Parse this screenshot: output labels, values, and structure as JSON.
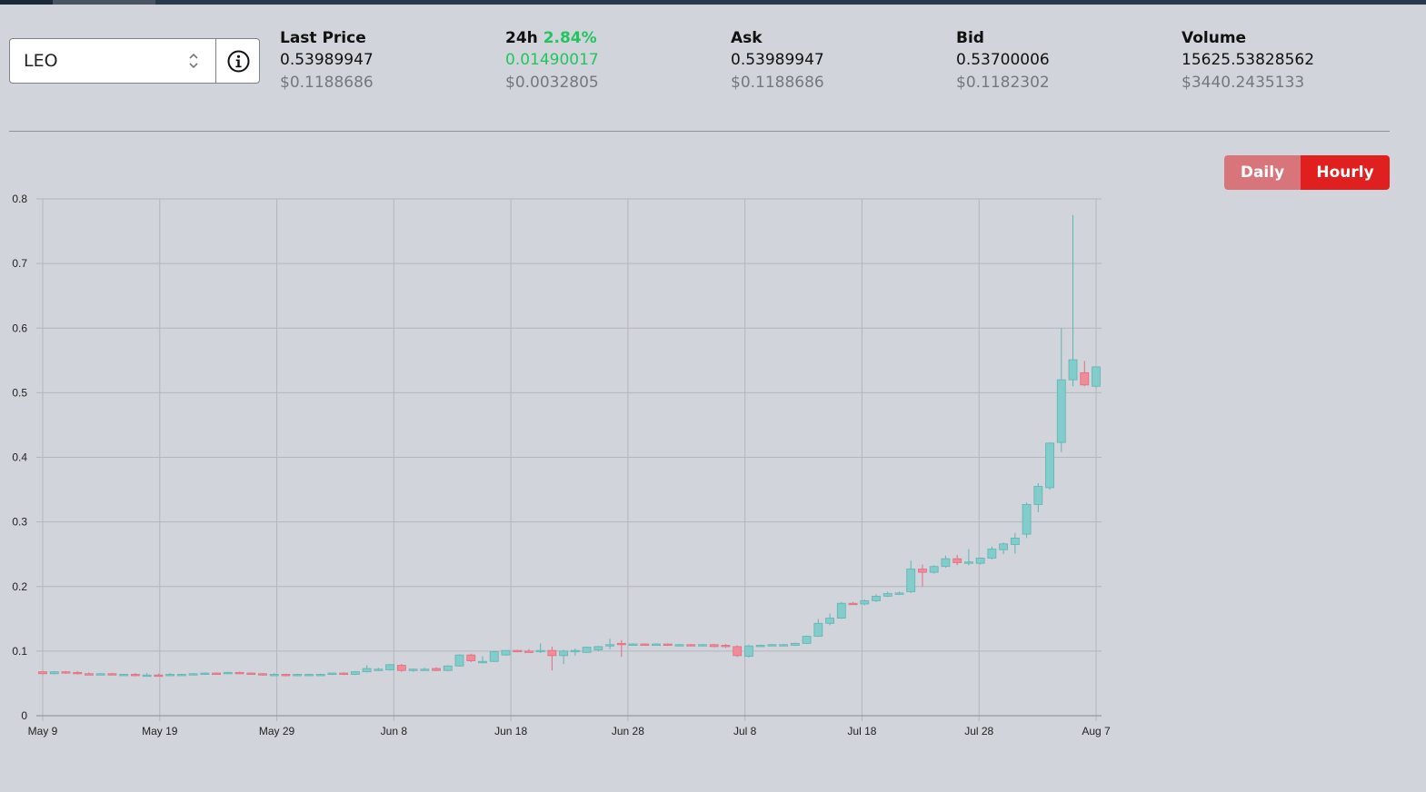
{
  "market": {
    "pair": "LEO",
    "stats": [
      {
        "label": "Last Price",
        "value": "0.53989947",
        "usd": "$0.1188686"
      },
      {
        "label": "24h",
        "pct": "2.84%",
        "value": "0.01490017",
        "usd": "$0.0032805"
      },
      {
        "label": "Ask",
        "value": "0.53989947",
        "usd": "$0.1188686"
      },
      {
        "label": "Bid",
        "value": "0.53700006",
        "usd": "$0.1182302"
      },
      {
        "label": "Volume",
        "value": "15625.53828562",
        "usd": "$3440.2435133"
      }
    ]
  },
  "toggle": {
    "daily": "Daily",
    "hourly": "Hourly",
    "active": "hourly"
  },
  "icons": {
    "pair_select": "up-down-chevron-icon",
    "info": "info-circle-icon"
  },
  "colors": {
    "up": "#82cccb",
    "down": "#f18b9a",
    "positive_text": "#22c55e",
    "hourly_active": "#e0201f",
    "daily_inactive": "#d8757a"
  },
  "chart_data": {
    "type": "candlestick",
    "x_range": [
      "May 9",
      "Aug 7"
    ],
    "ylim": [
      0,
      0.8
    ],
    "y_ticks": [
      0,
      0.1,
      0.2,
      0.3,
      0.4,
      0.5,
      0.6,
      0.7,
      0.8
    ],
    "x_ticks": [
      "May 9",
      "May 19",
      "May 29",
      "Jun 8",
      "Jun 18",
      "Jun 28",
      "Jul 8",
      "Jul 18",
      "Jul 28",
      "Aug 7"
    ],
    "grid": true,
    "candles": [
      {
        "date": "May 9",
        "open": 0.068,
        "high": 0.069,
        "low": 0.064,
        "close": 0.065
      },
      {
        "date": "May 10",
        "open": 0.065,
        "high": 0.069,
        "low": 0.064,
        "close": 0.068
      },
      {
        "date": "May 11",
        "open": 0.068,
        "high": 0.069,
        "low": 0.065,
        "close": 0.067
      },
      {
        "date": "May 12",
        "open": 0.067,
        "high": 0.069,
        "low": 0.064,
        "close": 0.065
      },
      {
        "date": "May 13",
        "open": 0.065,
        "high": 0.067,
        "low": 0.063,
        "close": 0.064
      },
      {
        "date": "May 14",
        "open": 0.064,
        "high": 0.066,
        "low": 0.063,
        "close": 0.065
      },
      {
        "date": "May 15",
        "open": 0.065,
        "high": 0.066,
        "low": 0.064,
        "close": 0.064
      },
      {
        "date": "May 16",
        "open": 0.064,
        "high": 0.065,
        "low": 0.063,
        "close": 0.064
      },
      {
        "date": "May 17",
        "open": 0.064,
        "high": 0.066,
        "low": 0.061,
        "close": 0.062
      },
      {
        "date": "May 18",
        "open": 0.062,
        "high": 0.066,
        "low": 0.061,
        "close": 0.063
      },
      {
        "date": "May 19",
        "open": 0.063,
        "high": 0.065,
        "low": 0.061,
        "close": 0.062
      },
      {
        "date": "May 20",
        "open": 0.062,
        "high": 0.066,
        "low": 0.062,
        "close": 0.064
      },
      {
        "date": "May 21",
        "open": 0.064,
        "high": 0.065,
        "low": 0.063,
        "close": 0.064
      },
      {
        "date": "May 22",
        "open": 0.064,
        "high": 0.066,
        "low": 0.064,
        "close": 0.065
      },
      {
        "date": "May 23",
        "open": 0.065,
        "high": 0.067,
        "low": 0.064,
        "close": 0.066
      },
      {
        "date": "May 24",
        "open": 0.066,
        "high": 0.067,
        "low": 0.064,
        "close": 0.065
      },
      {
        "date": "May 25",
        "open": 0.065,
        "high": 0.068,
        "low": 0.065,
        "close": 0.067
      },
      {
        "date": "May 26",
        "open": 0.067,
        "high": 0.068,
        "low": 0.065,
        "close": 0.066
      },
      {
        "date": "May 27",
        "open": 0.066,
        "high": 0.067,
        "low": 0.064,
        "close": 0.065
      },
      {
        "date": "May 28",
        "open": 0.065,
        "high": 0.066,
        "low": 0.062,
        "close": 0.063
      },
      {
        "date": "May 29",
        "open": 0.063,
        "high": 0.066,
        "low": 0.062,
        "close": 0.064
      },
      {
        "date": "May 30",
        "open": 0.064,
        "high": 0.065,
        "low": 0.061,
        "close": 0.062
      },
      {
        "date": "May 31",
        "open": 0.062,
        "high": 0.065,
        "low": 0.061,
        "close": 0.064
      },
      {
        "date": "Jun 1",
        "open": 0.064,
        "high": 0.065,
        "low": 0.063,
        "close": 0.064
      },
      {
        "date": "Jun 2",
        "open": 0.063,
        "high": 0.065,
        "low": 0.062,
        "close": 0.064
      },
      {
        "date": "Jun 3",
        "open": 0.064,
        "high": 0.066,
        "low": 0.063,
        "close": 0.066
      },
      {
        "date": "Jun 4",
        "open": 0.066,
        "high": 0.067,
        "low": 0.063,
        "close": 0.064
      },
      {
        "date": "Jun 5",
        "open": 0.064,
        "high": 0.069,
        "low": 0.063,
        "close": 0.068
      },
      {
        "date": "Jun 6",
        "open": 0.068,
        "high": 0.078,
        "low": 0.067,
        "close": 0.073
      },
      {
        "date": "Jun 7",
        "open": 0.071,
        "high": 0.074,
        "low": 0.069,
        "close": 0.072
      },
      {
        "date": "Jun 8",
        "open": 0.071,
        "high": 0.08,
        "low": 0.07,
        "close": 0.079
      },
      {
        "date": "Jun 9",
        "open": 0.078,
        "high": 0.08,
        "low": 0.068,
        "close": 0.07
      },
      {
        "date": "Jun 10",
        "open": 0.07,
        "high": 0.073,
        "low": 0.068,
        "close": 0.072
      },
      {
        "date": "Jun 11",
        "open": 0.071,
        "high": 0.074,
        "low": 0.07,
        "close": 0.072
      },
      {
        "date": "Jun 12",
        "open": 0.073,
        "high": 0.075,
        "low": 0.069,
        "close": 0.07
      },
      {
        "date": "Jun 13",
        "open": 0.07,
        "high": 0.078,
        "low": 0.069,
        "close": 0.077
      },
      {
        "date": "Jun 14",
        "open": 0.077,
        "high": 0.095,
        "low": 0.076,
        "close": 0.094
      },
      {
        "date": "Jun 15",
        "open": 0.094,
        "high": 0.096,
        "low": 0.083,
        "close": 0.085
      },
      {
        "date": "Jun 16",
        "open": 0.083,
        "high": 0.092,
        "low": 0.081,
        "close": 0.084
      },
      {
        "date": "Jun 17",
        "open": 0.084,
        "high": 0.1,
        "low": 0.083,
        "close": 0.099
      },
      {
        "date": "Jun 18",
        "open": 0.094,
        "high": 0.101,
        "low": 0.093,
        "close": 0.101
      },
      {
        "date": "Jun 19",
        "open": 0.101,
        "high": 0.102,
        "low": 0.099,
        "close": 0.1
      },
      {
        "date": "Jun 20",
        "open": 0.1,
        "high": 0.103,
        "low": 0.098,
        "close": 0.099
      },
      {
        "date": "Jun 21",
        "open": 0.099,
        "high": 0.112,
        "low": 0.097,
        "close": 0.101
      },
      {
        "date": "Jun 22",
        "open": 0.101,
        "high": 0.107,
        "low": 0.07,
        "close": 0.093
      },
      {
        "date": "Jun 23",
        "open": 0.093,
        "high": 0.102,
        "low": 0.08,
        "close": 0.1
      },
      {
        "date": "Jun 24",
        "open": 0.099,
        "high": 0.104,
        "low": 0.093,
        "close": 0.101
      },
      {
        "date": "Jun 25",
        "open": 0.098,
        "high": 0.107,
        "low": 0.097,
        "close": 0.106
      },
      {
        "date": "Jun 26",
        "open": 0.102,
        "high": 0.108,
        "low": 0.1,
        "close": 0.107
      },
      {
        "date": "Jun 27",
        "open": 0.108,
        "high": 0.119,
        "low": 0.103,
        "close": 0.11
      },
      {
        "date": "Jun 28",
        "open": 0.112,
        "high": 0.117,
        "low": 0.091,
        "close": 0.11
      },
      {
        "date": "Jun 29",
        "open": 0.11,
        "high": 0.112,
        "low": 0.109,
        "close": 0.111
      },
      {
        "date": "Jun 30",
        "open": 0.111,
        "high": 0.112,
        "low": 0.109,
        "close": 0.11
      },
      {
        "date": "Jul 1",
        "open": 0.11,
        "high": 0.112,
        "low": 0.109,
        "close": 0.111
      },
      {
        "date": "Jul 2",
        "open": 0.111,
        "high": 0.112,
        "low": 0.108,
        "close": 0.109
      },
      {
        "date": "Jul 3",
        "open": 0.109,
        "high": 0.111,
        "low": 0.108,
        "close": 0.11
      },
      {
        "date": "Jul 4",
        "open": 0.11,
        "high": 0.111,
        "low": 0.108,
        "close": 0.109
      },
      {
        "date": "Jul 5",
        "open": 0.109,
        "high": 0.111,
        "low": 0.108,
        "close": 0.11
      },
      {
        "date": "Jul 6",
        "open": 0.11,
        "high": 0.111,
        "low": 0.106,
        "close": 0.107
      },
      {
        "date": "Jul 7",
        "open": 0.109,
        "high": 0.111,
        "low": 0.105,
        "close": 0.107
      },
      {
        "date": "Jul 8",
        "open": 0.107,
        "high": 0.109,
        "low": 0.091,
        "close": 0.093
      },
      {
        "date": "Jul 9",
        "open": 0.092,
        "high": 0.11,
        "low": 0.09,
        "close": 0.108
      },
      {
        "date": "Jul 10",
        "open": 0.108,
        "high": 0.11,
        "low": 0.107,
        "close": 0.109
      },
      {
        "date": "Jul 11",
        "open": 0.109,
        "high": 0.111,
        "low": 0.108,
        "close": 0.11
      },
      {
        "date": "Jul 12",
        "open": 0.11,
        "high": 0.111,
        "low": 0.109,
        "close": 0.11
      },
      {
        "date": "Jul 13",
        "open": 0.109,
        "high": 0.113,
        "low": 0.108,
        "close": 0.112
      },
      {
        "date": "Jul 14",
        "open": 0.112,
        "high": 0.124,
        "low": 0.111,
        "close": 0.123
      },
      {
        "date": "Jul 15",
        "open": 0.123,
        "high": 0.15,
        "low": 0.122,
        "close": 0.143
      },
      {
        "date": "Jul 16",
        "open": 0.143,
        "high": 0.158,
        "low": 0.14,
        "close": 0.151
      },
      {
        "date": "Jul 17",
        "open": 0.151,
        "high": 0.176,
        "low": 0.15,
        "close": 0.174
      },
      {
        "date": "Jul 18",
        "open": 0.174,
        "high": 0.176,
        "low": 0.172,
        "close": 0.173
      },
      {
        "date": "Jul 19",
        "open": 0.173,
        "high": 0.18,
        "low": 0.171,
        "close": 0.178
      },
      {
        "date": "Jul 20",
        "open": 0.178,
        "high": 0.188,
        "low": 0.176,
        "close": 0.185
      },
      {
        "date": "Jul 21",
        "open": 0.185,
        "high": 0.192,
        "low": 0.184,
        "close": 0.189
      },
      {
        "date": "Jul 22",
        "open": 0.189,
        "high": 0.192,
        "low": 0.187,
        "close": 0.19
      },
      {
        "date": "Jul 23",
        "open": 0.192,
        "high": 0.24,
        "low": 0.19,
        "close": 0.227
      },
      {
        "date": "Jul 24",
        "open": 0.227,
        "high": 0.234,
        "low": 0.2,
        "close": 0.222
      },
      {
        "date": "Jul 25",
        "open": 0.222,
        "high": 0.233,
        "low": 0.22,
        "close": 0.231
      },
      {
        "date": "Jul 26",
        "open": 0.231,
        "high": 0.248,
        "low": 0.229,
        "close": 0.243
      },
      {
        "date": "Jul 27",
        "open": 0.243,
        "high": 0.249,
        "low": 0.233,
        "close": 0.237
      },
      {
        "date": "Jul 28",
        "open": 0.237,
        "high": 0.258,
        "low": 0.233,
        "close": 0.238
      },
      {
        "date": "Jul 29",
        "open": 0.236,
        "high": 0.245,
        "low": 0.234,
        "close": 0.244
      },
      {
        "date": "Jul 30",
        "open": 0.244,
        "high": 0.262,
        "low": 0.242,
        "close": 0.258
      },
      {
        "date": "Jul 31",
        "open": 0.257,
        "high": 0.268,
        "low": 0.25,
        "close": 0.266
      },
      {
        "date": "Aug 1",
        "open": 0.265,
        "high": 0.283,
        "low": 0.251,
        "close": 0.275
      },
      {
        "date": "Aug 2",
        "open": 0.281,
        "high": 0.33,
        "low": 0.275,
        "close": 0.327
      },
      {
        "date": "Aug 3",
        "open": 0.327,
        "high": 0.36,
        "low": 0.315,
        "close": 0.355
      },
      {
        "date": "Aug 4",
        "open": 0.353,
        "high": 0.423,
        "low": 0.35,
        "close": 0.422
      },
      {
        "date": "Aug 5",
        "open": 0.423,
        "high": 0.6,
        "low": 0.408,
        "close": 0.52
      },
      {
        "date": "Aug 6",
        "open": 0.52,
        "high": 0.775,
        "low": 0.51,
        "close": 0.551
      },
      {
        "date": "Aug 6 12:00",
        "open": 0.531,
        "high": 0.549,
        "low": 0.51,
        "close": 0.512
      },
      {
        "date": "Aug 7",
        "open": 0.51,
        "high": 0.54,
        "low": 0.507,
        "close": 0.54
      }
    ]
  }
}
